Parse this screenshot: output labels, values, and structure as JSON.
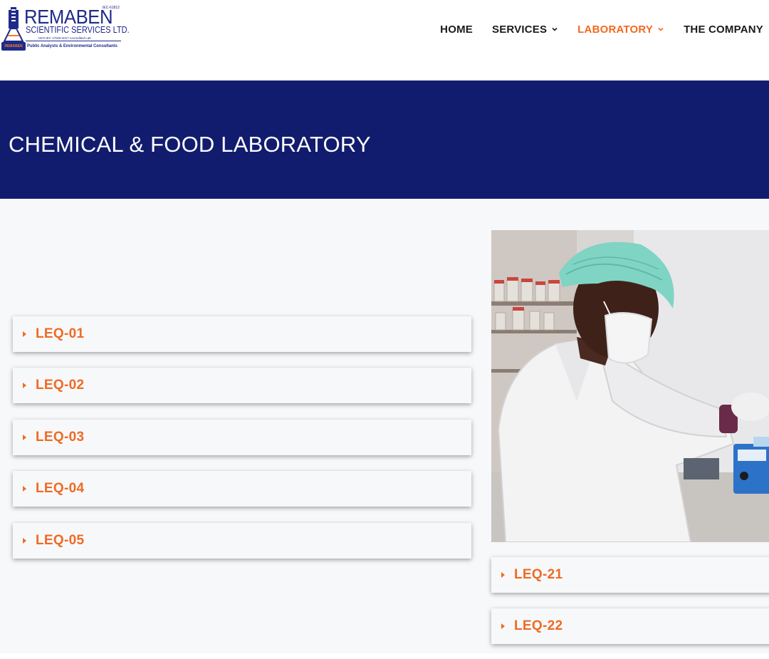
{
  "header": {
    "logo": {
      "brand": "REMABEN",
      "subtitle": "SCIENTIFIC SERVICES LTD.",
      "iso_code": "IEC-61812",
      "accreditation": "ISO/ IEC 17025:2017 Accredited Lab",
      "tagline": "Public Analysts & Environmental Consultants",
      "badge": "REMABEN"
    },
    "nav": [
      {
        "label": "HOME",
        "has_dropdown": false,
        "active": false
      },
      {
        "label": "SERVICES",
        "has_dropdown": true,
        "active": false
      },
      {
        "label": "LABORATORY",
        "has_dropdown": true,
        "active": true
      },
      {
        "label": "THE COMPANY",
        "has_dropdown": false,
        "active": false
      }
    ]
  },
  "banner": {
    "title": "CHEMICAL & FOOD LABORATORY"
  },
  "left_accordion": [
    {
      "label": "LEQ-01"
    },
    {
      "label": "LEQ-02"
    },
    {
      "label": "LEQ-03"
    },
    {
      "label": "LEQ-04"
    },
    {
      "label": "LEQ-05"
    }
  ],
  "right_accordion": [
    {
      "label": "LEQ-21"
    },
    {
      "label": "LEQ-22"
    }
  ],
  "colors": {
    "brand_navy": "#121c6e",
    "accent_orange": "#ef6a22",
    "content_bg": "#f7f8fa",
    "text_dark": "#1b1b1b"
  },
  "icons": {
    "nav_dropdown": "chevron-down-icon",
    "accordion_toggle": "caret-right-icon"
  }
}
